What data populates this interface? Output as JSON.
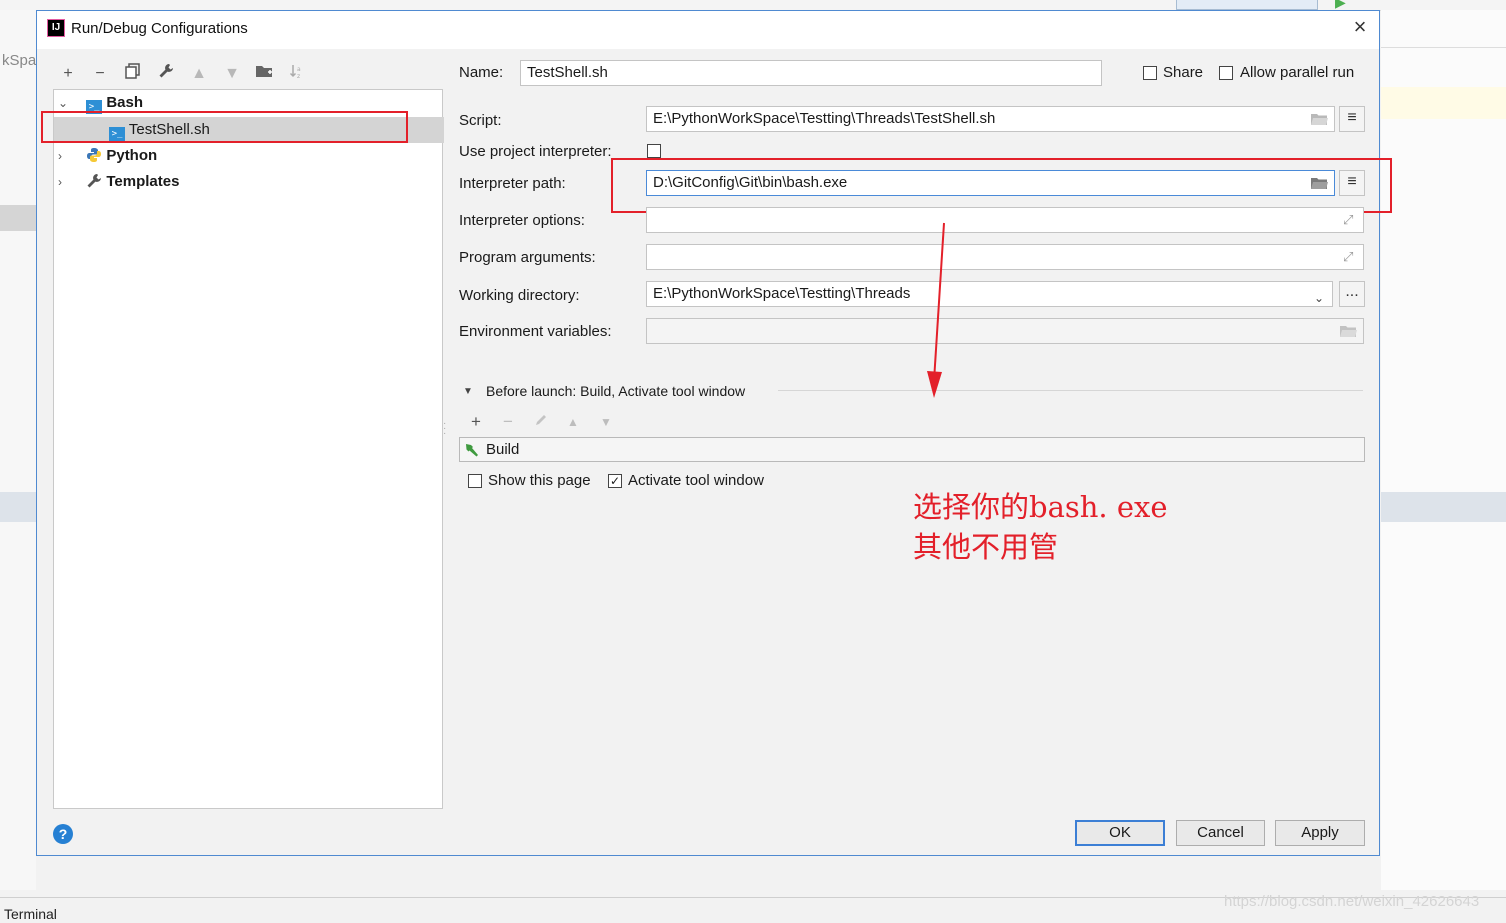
{
  "background": {
    "left_partial": "kSpac",
    "terminal_tab": "Terminal",
    "watermark": "https://blog.csdn.net/weixin_42626643"
  },
  "dialog": {
    "title": "Run/Debug Configurations",
    "tree": {
      "bash": "Bash",
      "testshell": "TestShell.sh",
      "python": "Python",
      "templates": "Templates"
    },
    "form": {
      "name_label": "Name:",
      "name_value": "TestShell.sh",
      "share_label": "Share",
      "parallel_label": "Allow parallel run",
      "script_label": "Script:",
      "script_value": "E:\\PythonWorkSpace\\Testting\\Threads\\TestShell.sh",
      "use_interp_label": "Use project interpreter:",
      "interp_path_label": "Interpreter path:",
      "interp_path_value": "D:\\GitConfig\\Git\\bin\\bash.exe",
      "interp_opts_label": "Interpreter options:",
      "prog_args_label": "Program arguments:",
      "workdir_label": "Working directory:",
      "workdir_value": "E:\\PythonWorkSpace\\Testting\\Threads",
      "env_label": "Environment variables:",
      "browse_label": "..."
    },
    "before_launch": {
      "header": "Before launch: Build, Activate tool window",
      "build_item": "Build",
      "show_page_label": "Show this page",
      "activate_label": "Activate tool window"
    },
    "annotation": {
      "line1": "选择你的bash. exe",
      "line2": "其他不用管"
    },
    "buttons": {
      "ok": "OK",
      "cancel": "Cancel",
      "apply": "Apply",
      "help": "?"
    }
  },
  "colors": {
    "accent": "#4a8ad8",
    "annotation": "#e3202a"
  }
}
